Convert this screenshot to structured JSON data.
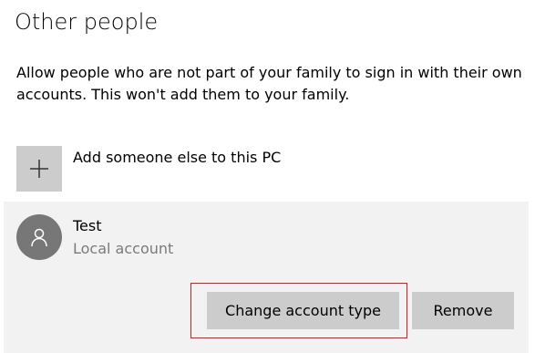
{
  "section": {
    "title": "Other people",
    "description": "Allow people who are not part of your family to sign in with their own accounts. This won't add them to your family."
  },
  "add_person": {
    "label": "Add someone else to this PC",
    "icon": "plus-icon"
  },
  "account": {
    "name": "Test",
    "type": "Local account",
    "avatar_icon": "person-icon",
    "change_type_label": "Change account type",
    "remove_label": "Remove"
  },
  "colors": {
    "tile": "#cccccc",
    "panel": "#f2f2f2",
    "avatar": "#777777",
    "highlight": "#e0191d",
    "secondary_text": "#7a7a7a"
  }
}
